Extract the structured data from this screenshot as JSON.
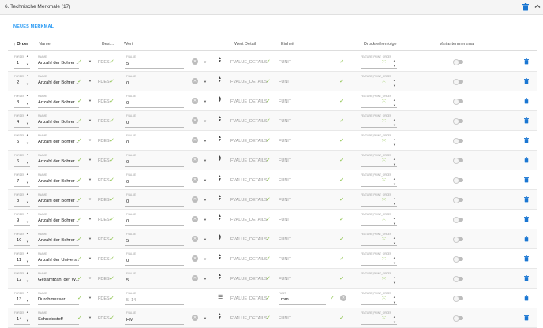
{
  "section": {
    "title": "6. Technische Merkmale (17)",
    "trash_icon": "trash-icon",
    "collapse_icon": "chevron-up-icon"
  },
  "new_button": "NEUES MERKMAL",
  "columns": {
    "order": "Order",
    "name": "Name",
    "besi": "Besi...",
    "wert": "Wert",
    "wert_detail": "Wert Detail",
    "einheit": "Einheit",
    "druck": "Druckreihenfolge",
    "variant": "Variantenmerkmal"
  },
  "labels": {
    "order_small": "FORDER",
    "name_small": "FNAME",
    "wert_small": "FVALUE",
    "unit_small": "FUNIT",
    "druck_small": "FEATURE_PRINT_ORDER"
  },
  "rows": [
    {
      "order": "1",
      "name": "Anzahl der Bohrer ...",
      "besi": "FDESI",
      "wert": "5",
      "detail": "FVALUE_DETAILS",
      "unit": "FUNIT"
    },
    {
      "order": "2",
      "name": "Anzahl der Bohrer ...",
      "besi": "FDESI",
      "wert": "0",
      "detail": "FVALUE_DETAILS",
      "unit": "FUNIT"
    },
    {
      "order": "3",
      "name": "Anzahl der Bohrer ...",
      "besi": "FDESI",
      "wert": "0",
      "detail": "FVALUE_DETAILS",
      "unit": "FUNIT"
    },
    {
      "order": "4",
      "name": "Anzahl der Bohrer ...",
      "besi": "FDESI",
      "wert": "0",
      "detail": "FVALUE_DETAILS",
      "unit": "FUNIT"
    },
    {
      "order": "5",
      "name": "Anzahl der Bohrer ...",
      "besi": "FDESI",
      "wert": "0",
      "detail": "FVALUE_DETAILS",
      "unit": "FUNIT"
    },
    {
      "order": "6",
      "name": "Anzahl der Bohrer ...",
      "besi": "FDESI",
      "wert": "0",
      "detail": "FVALUE_DETAILS",
      "unit": "FUNIT"
    },
    {
      "order": "7",
      "name": "Anzahl der Bohrer ...",
      "besi": "FDESI",
      "wert": "0",
      "detail": "FVALUE_DETAILS",
      "unit": "FUNIT"
    },
    {
      "order": "8",
      "name": "Anzahl der Bohrer ...",
      "besi": "FDESI",
      "wert": "0",
      "detail": "FVALUE_DETAILS",
      "unit": "FUNIT"
    },
    {
      "order": "9",
      "name": "Anzahl der Bohrer ...",
      "besi": "FDESI",
      "wert": "0",
      "detail": "FVALUE_DETAILS",
      "unit": "FUNIT"
    },
    {
      "order": "10",
      "name": "Anzahl der Bohrer ...",
      "besi": "FDESI",
      "wert": "5",
      "detail": "FVALUE_DETAILS",
      "unit": "FUNIT"
    },
    {
      "order": "11",
      "name": "Anzahl der Univers...",
      "besi": "FDESI",
      "wert": "0",
      "detail": "FVALUE_DETAILS",
      "unit": "FUNIT"
    },
    {
      "order": "12",
      "name": "Gesamtzahl der W...",
      "besi": "FDESI",
      "wert": "5",
      "detail": "FVALUE_DETAILS",
      "unit": "FUNIT"
    },
    {
      "order": "13",
      "name": "Durchmesser",
      "besi": "FDESI",
      "wert": "5, 14",
      "detail": "FVALUE_DETAILS",
      "unit": "mm",
      "type": "list"
    },
    {
      "order": "14",
      "name": "Schneidstoff",
      "besi": "FDESI",
      "wert": "HM",
      "detail": "FVALUE_DETAILS",
      "unit": "FUNIT"
    }
  ]
}
